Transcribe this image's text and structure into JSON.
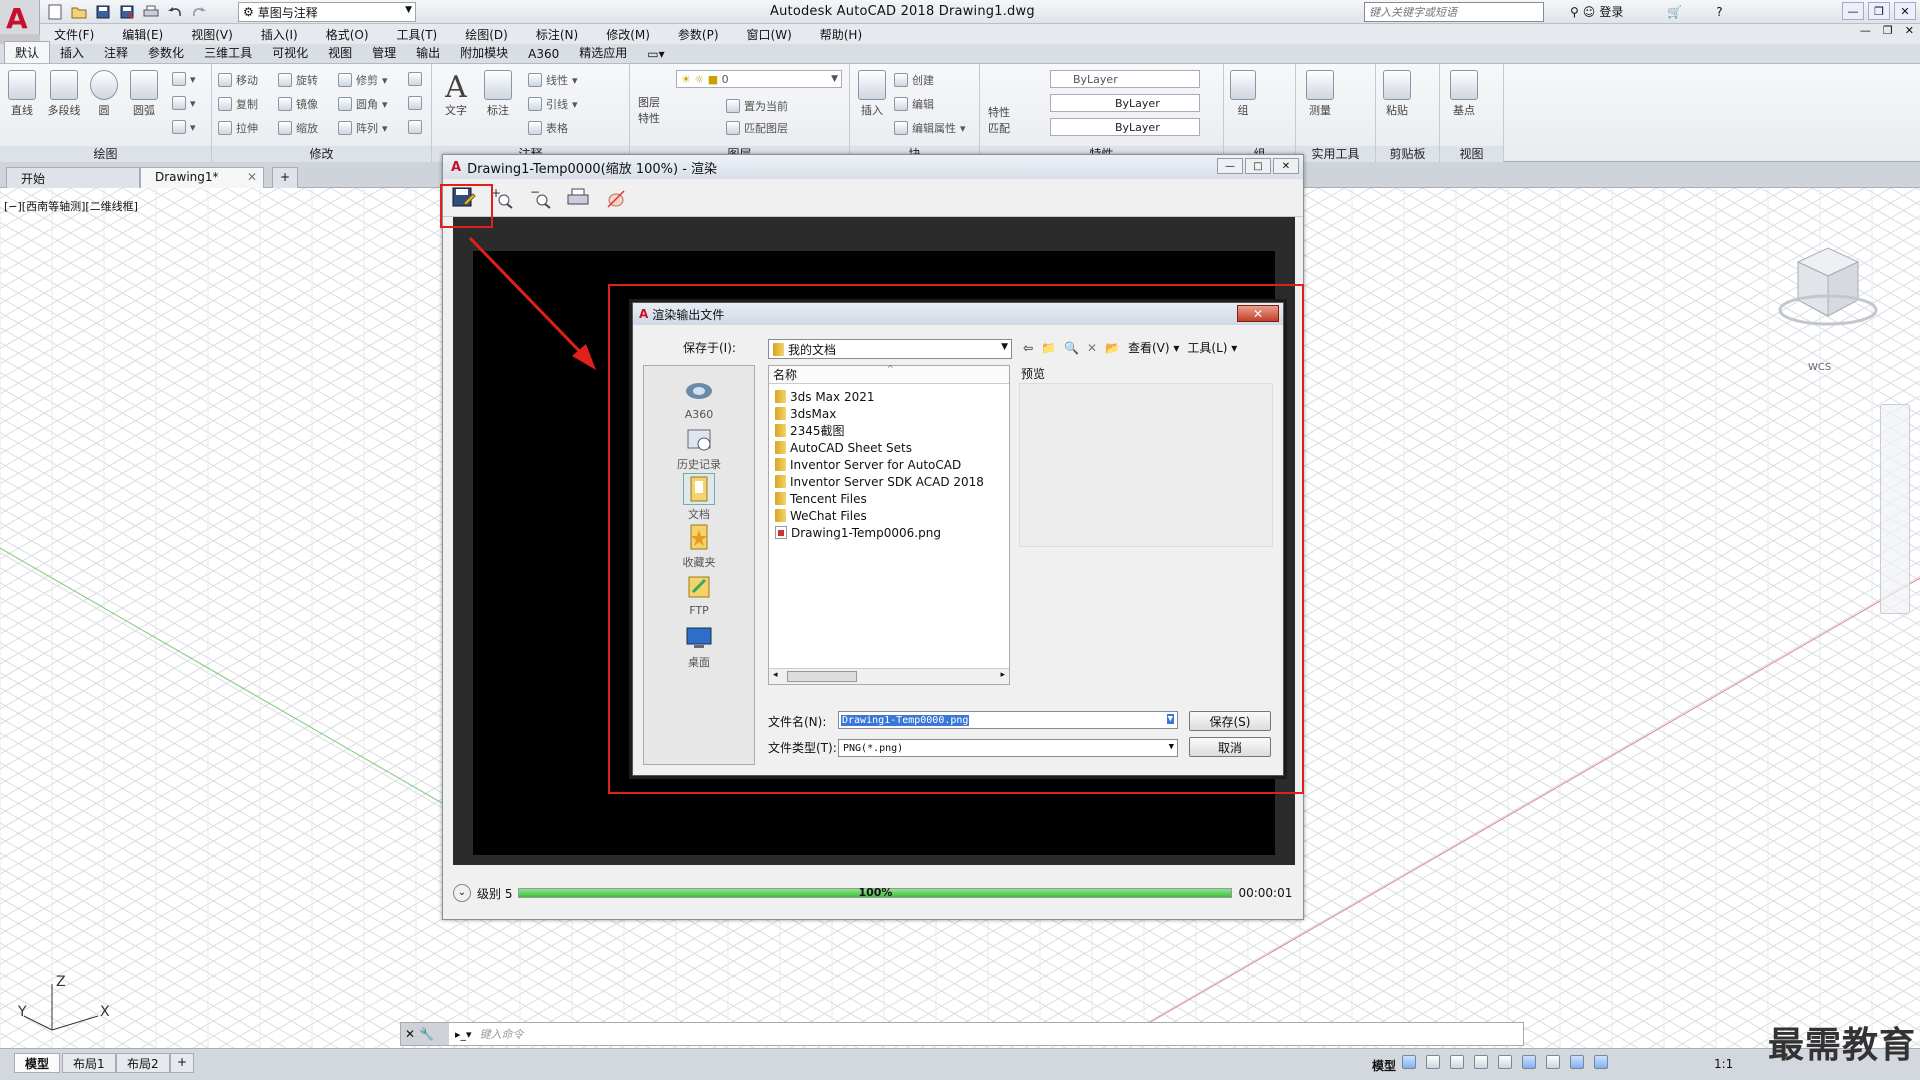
{
  "app": {
    "title": "Autodesk AutoCAD 2018    Drawing1.dwg",
    "workspace": "草图与注释",
    "search_placeholder": "键入关键字或短语",
    "login": "登录"
  },
  "menu": [
    "文件(F)",
    "编辑(E)",
    "视图(V)",
    "插入(I)",
    "格式(O)",
    "工具(T)",
    "绘图(D)",
    "标注(N)",
    "修改(M)",
    "参数(P)",
    "窗口(W)",
    "帮助(H)"
  ],
  "ribbon_tabs": [
    "默认",
    "插入",
    "注释",
    "参数化",
    "三维工具",
    "可视化",
    "视图",
    "管理",
    "输出",
    "附加模块",
    "A360",
    "精选应用"
  ],
  "ribbon": {
    "draw": {
      "title": "绘图",
      "line": "直线",
      "polyline": "多段线",
      "circle": "圆",
      "arc": "圆弧"
    },
    "modify": {
      "title": "修改",
      "move": "移动",
      "rotate": "旋转",
      "trim": "修剪",
      "copy": "复制",
      "mirror": "镜像",
      "fillet": "圆角",
      "stretch": "拉伸",
      "scale": "缩放",
      "array": "阵列"
    },
    "annotation": {
      "title": "注释",
      "text": "文字",
      "dimension": "标注",
      "linear": "线性",
      "leader": "引线",
      "table": "表格"
    },
    "layers": {
      "title": "图层",
      "props": "图层特性",
      "layer_value": "0",
      "set_current": "置为当前",
      "match": "匹配图层"
    },
    "block": {
      "title": "块",
      "insert": "插入",
      "create": "创建",
      "edit": "编辑",
      "edit_attr": "编辑属性"
    },
    "properties": {
      "title": "特性",
      "match": "特性匹配",
      "color": "ByLayer",
      "linetype": "ByLayer",
      "lineweight": "ByLayer"
    },
    "groups": {
      "title": "组",
      "group": "组"
    },
    "utilities": {
      "title": "实用工具",
      "measure": "测量"
    },
    "clipboard": {
      "title": "剪贴板",
      "paste": "粘贴"
    },
    "view": {
      "title": "视图",
      "base": "基点"
    }
  },
  "doc_tabs": [
    "开始",
    "Drawing1*"
  ],
  "viewport_label": "[−][西南等轴测][二维线框]",
  "wcs": "WCS",
  "ucs": {
    "x": "X",
    "y": "Y",
    "z": "Z"
  },
  "render_window": {
    "title": "Drawing1-Temp0000(缩放 100%) - 渲染",
    "level": "级别 5",
    "progress": 1.0,
    "progress_text": "100%",
    "time": "00:00:01"
  },
  "dialog": {
    "title": "渲染输出文件",
    "save_in_label": "保存于(I):",
    "save_in_value": "我的文档",
    "view_menu": "查看(V)",
    "tools_menu": "工具(L)",
    "places": [
      "A360",
      "历史记录",
      "文档",
      "收藏夹",
      "FTP",
      "桌面"
    ],
    "column_name": "名称",
    "preview_label": "预览",
    "files": [
      {
        "name": "3ds Max 2021",
        "type": "folder"
      },
      {
        "name": "3dsMax",
        "type": "folder"
      },
      {
        "name": "2345截图",
        "type": "folder"
      },
      {
        "name": "AutoCAD Sheet Sets",
        "type": "folder"
      },
      {
        "name": "Inventor Server for AutoCAD",
        "type": "folder"
      },
      {
        "name": "Inventor Server SDK ACAD 2018",
        "type": "folder"
      },
      {
        "name": "Tencent Files",
        "type": "folder"
      },
      {
        "name": "WeChat Files",
        "type": "folder"
      },
      {
        "name": "Drawing1-Temp0006.png",
        "type": "png"
      }
    ],
    "filename_label": "文件名(N):",
    "filename_value": "Drawing1-Temp0000.png",
    "filetype_label": "文件类型(T):",
    "filetype_value": "PNG(*.png)",
    "save_button": "保存(S)",
    "cancel_button": "取消"
  },
  "command_prompt": "键入命令",
  "layout_tabs": [
    "模型",
    "布局1",
    "布局2"
  ],
  "status": {
    "model": "模型",
    "scale": "1:1"
  },
  "watermark": "最需教育",
  "colors": {
    "accent": "#e0201a",
    "progress": "#3cbf3c",
    "autocad_red": "#c8102e"
  }
}
